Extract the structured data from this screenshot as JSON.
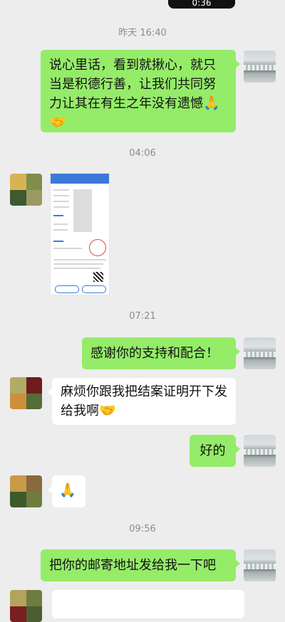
{
  "status_bar": {
    "time": "0:36"
  },
  "timestamps": [
    "昨天 16:40",
    "04:06",
    "07:21",
    "09:56"
  ],
  "messages": [
    {
      "side": "sent",
      "text": "说心里话，看到就揪心，就只当是积德行善，让我们共同努力让其在有生之年没有遗憾",
      "emoji": "🙏🤝"
    },
    {
      "side": "recv",
      "type": "image",
      "description": "document-screenshot"
    },
    {
      "side": "sent",
      "text": "感谢你的支持和配合！"
    },
    {
      "side": "recv",
      "text": "麻烦你跟我把结案证明开下发给我啊",
      "emoji": "🤝"
    },
    {
      "side": "sent",
      "text": "好的"
    },
    {
      "side": "recv",
      "emoji": "🙏"
    },
    {
      "side": "sent",
      "text": "把你的邮寄地址发给我一下吧"
    },
    {
      "side": "recv",
      "text": ""
    }
  ],
  "colors": {
    "sent_bubble": "#95ec69",
    "recv_bubble": "#ffffff",
    "background": "#ededed"
  },
  "icons": {
    "self_avatar": "waterfall-landscape-avatar",
    "contact_avatar": "mosaic-avatar"
  }
}
